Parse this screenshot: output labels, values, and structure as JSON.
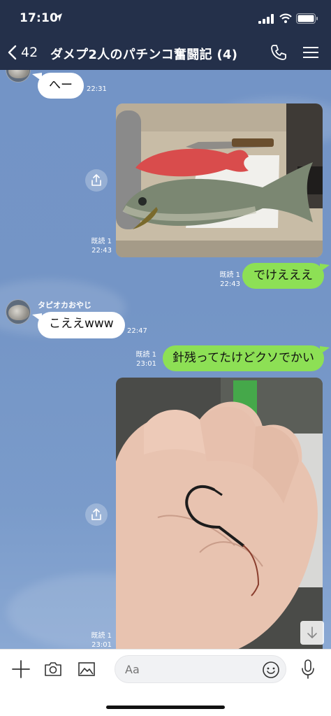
{
  "status_bar": {
    "time": "17:10"
  },
  "header": {
    "back_count": "42",
    "title": "ダメプ2人のパチンコ奮闘記 (4)"
  },
  "messages": {
    "m1": {
      "text": "へー",
      "time": "22:31"
    },
    "photo1": {
      "read": "既読 1",
      "time": "22:43"
    },
    "m2": {
      "text": "でけえええ",
      "read": "既読 1",
      "time": "22:43"
    },
    "m3": {
      "sender": "タピオカおやじ",
      "text": "こええwww",
      "time": "22:47"
    },
    "m4": {
      "text": "針残ってたけどクソでかい",
      "read": "既読 1",
      "time": "23:01"
    },
    "photo2": {
      "read": "既読 1",
      "time": "23:01"
    }
  },
  "input": {
    "placeholder": "Aa"
  },
  "icons": [
    "location-arrow-icon",
    "signal-icon",
    "wifi-icon",
    "battery-icon",
    "back-chevron-icon",
    "phone-icon",
    "menu-icon",
    "share-icon",
    "arrow-down-icon",
    "plus-icon",
    "camera-icon",
    "image-icon",
    "emoji-icon",
    "microphone-icon"
  ],
  "colors": {
    "header_bg": "#24304a",
    "chat_bg": "#7495c6",
    "outgoing_bubble": "#8de055",
    "incoming_bubble": "#ffffff"
  }
}
